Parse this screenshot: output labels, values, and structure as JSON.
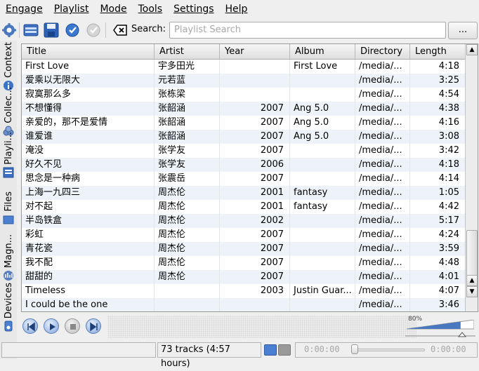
{
  "menubar": {
    "items": [
      {
        "label": "Engage",
        "accel_index": 0
      },
      {
        "label": "Playlist",
        "accel_index": 0
      },
      {
        "label": "Mode",
        "accel_index": 0
      },
      {
        "label": "Tools",
        "accel_index": 0
      },
      {
        "label": "Settings",
        "accel_index": 0
      },
      {
        "label": "Help",
        "accel_index": 0
      }
    ]
  },
  "toolbar": {
    "search_label": "Search:",
    "search_placeholder": "Playlist Search",
    "options_button": "..."
  },
  "sidetabs": [
    {
      "label": "Context",
      "icon": "info-icon"
    },
    {
      "label": "Collec...",
      "icon": "collection-icon"
    },
    {
      "label": "Playli...",
      "icon": "playlist-icon"
    },
    {
      "label": "Files",
      "icon": "folder-icon"
    },
    {
      "label": "Magn...",
      "icon": "magnatune-icon"
    },
    {
      "label": "Devices",
      "icon": "device-icon"
    }
  ],
  "playlist": {
    "columns": [
      "Title",
      "Artist",
      "Year",
      "Album",
      "Directory",
      "Length"
    ],
    "rows": [
      [
        "First Love",
        "宇多田光",
        "",
        "First Love",
        "/media/...",
        "4:18"
      ],
      [
        "爱乘以无限大",
        "元若蓝",
        "",
        "",
        "/media/...",
        "3:25"
      ],
      [
        "寂寞那么多",
        "张栋梁",
        "",
        "",
        "/media/...",
        "4:54"
      ],
      [
        "不想懂得",
        "张韶涵",
        "2007",
        "Ang 5.0",
        "/media/...",
        "4:38"
      ],
      [
        "亲爱的，那不是爱情",
        "张韶涵",
        "2007",
        "Ang 5.0",
        "/media/...",
        "4:16"
      ],
      [
        "谁爱谁",
        "张韶涵",
        "2007",
        "Ang 5.0",
        "/media/...",
        "3:08"
      ],
      [
        "淹没",
        "张学友",
        "2007",
        "",
        "/media/...",
        "3:42"
      ],
      [
        "好久不见",
        "张学友",
        "2006",
        "",
        "/media/...",
        "4:18"
      ],
      [
        "思念是一种病",
        "张震岳",
        "2007",
        "",
        "/media/...",
        "4:14"
      ],
      [
        "上海一九四三",
        "周杰伦",
        "2001",
        "fantasy",
        "/media/...",
        "1:05"
      ],
      [
        "对不起",
        "周杰伦",
        "2001",
        "fantasy",
        "/media/...",
        "4:42"
      ],
      [
        "半岛铁盒",
        "周杰伦",
        "2002",
        "",
        "/media/...",
        "5:17"
      ],
      [
        "彩虹",
        "周杰伦",
        "2007",
        "",
        "/media/...",
        "4:24"
      ],
      [
        "青花瓷",
        "周杰伦",
        "2007",
        "",
        "/media/...",
        "3:59"
      ],
      [
        "我不配",
        "周杰伦",
        "2007",
        "",
        "/media/...",
        "4:48"
      ],
      [
        "甜甜的",
        "周杰伦",
        "2007",
        "",
        "/media/...",
        "4:01"
      ],
      [
        "Timeless",
        "",
        "2003",
        "Justin Guar...",
        "/media/...",
        "4:07"
      ],
      [
        "I could be the one",
        "",
        "",
        "",
        "/media/...",
        "3:46"
      ]
    ]
  },
  "player": {
    "volume_label": "80%",
    "volume": 0.8
  },
  "status": {
    "tracks": "73 tracks (4:57 hours)",
    "elapsed": "0:00:00",
    "remaining": "0:00:00"
  }
}
